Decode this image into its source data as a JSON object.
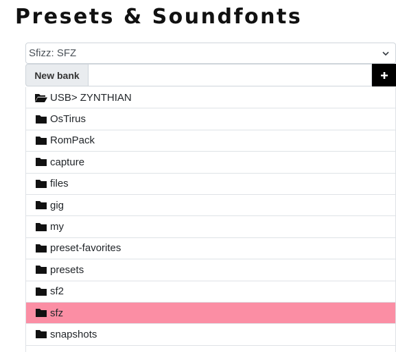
{
  "header": {
    "title": "Presets & Soundfonts"
  },
  "engine_select": {
    "value": "Sfizz: SFZ"
  },
  "new_bank": {
    "button_label": "New bank",
    "input_value": "",
    "add_label": "+"
  },
  "folders": {
    "current_path": "USB> ZYNTHIAN",
    "items": [
      {
        "label": "OsTirus",
        "selected": false
      },
      {
        "label": "RomPack",
        "selected": false
      },
      {
        "label": "capture",
        "selected": false
      },
      {
        "label": "files",
        "selected": false
      },
      {
        "label": "gig",
        "selected": false
      },
      {
        "label": "my",
        "selected": false
      },
      {
        "label": "preset-favorites",
        "selected": false
      },
      {
        "label": "presets",
        "selected": false
      },
      {
        "label": "sf2",
        "selected": false
      },
      {
        "label": "sfz",
        "selected": true
      },
      {
        "label": "snapshots",
        "selected": false
      }
    ]
  },
  "colors": {
    "selected_row": "#fb8ea4",
    "add_button": "#000000"
  },
  "icons": {
    "open_folder": "folder-open-icon",
    "folder": "folder-icon",
    "dropdown": "chevron-down-icon",
    "add": "plus-icon"
  }
}
